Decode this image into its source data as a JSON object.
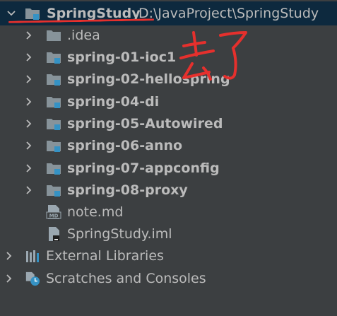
{
  "project": {
    "name": "SpringStudy",
    "path": "D:\\JavaProject\\SpringStudy"
  },
  "items": [
    {
      "label": ".idea"
    },
    {
      "label": "spring-01-ioc1"
    },
    {
      "label": "spring-02-hellospring"
    },
    {
      "label": "spring-04-di"
    },
    {
      "label": "spring-05-Autowired"
    },
    {
      "label": "spring-06-anno"
    },
    {
      "label": "spring-07-appconfig"
    },
    {
      "label": "spring-08-proxy"
    },
    {
      "label": "note.md"
    },
    {
      "label": "SpringStudy.iml"
    }
  ],
  "external_libraries": {
    "label": "External Libraries"
  },
  "scratches": {
    "label": "Scratches and Consoles"
  },
  "annotation": {
    "text": "去了",
    "color": "#e5302d"
  },
  "icons": {
    "folder": "folder-icon",
    "module": "module-folder-icon",
    "markdown": "markdown-file-icon",
    "iml": "iml-file-icon",
    "libraries": "libraries-icon",
    "scratches": "scratches-icon"
  },
  "colors": {
    "selection": "#0d293e",
    "text": "#bbbbbb",
    "folder": "#87939a",
    "module_badge": "#3592c4"
  }
}
